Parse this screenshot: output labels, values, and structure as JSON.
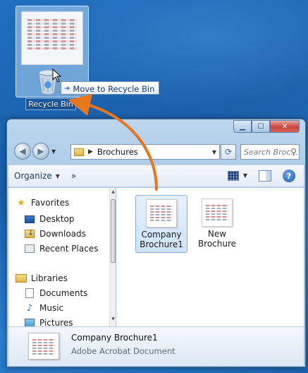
{
  "desktop": {
    "recycle_bin_label": "Recycle Bin",
    "drag_tooltip": "Move to Recycle Bin"
  },
  "window": {
    "address": {
      "folder": "Brochures"
    },
    "search": {
      "placeholder": "Search Broc..."
    },
    "toolbar": {
      "organize": "Organize",
      "more": "»"
    },
    "nav_pane": {
      "favorites_header": "Favorites",
      "favorites": [
        "Desktop",
        "Downloads",
        "Recent Places"
      ],
      "libraries_header": "Libraries",
      "libraries": [
        "Documents",
        "Music",
        "Pictures"
      ]
    },
    "files": [
      {
        "line1": "Company",
        "line2": "Brochure1",
        "selected": true
      },
      {
        "line1": "New",
        "line2": "Brochure",
        "selected": false
      }
    ],
    "details": {
      "name": "Company Brochure1",
      "type": "Adobe Acrobat Document"
    }
  },
  "colors": {
    "desktop_blue": "#1f6fc0",
    "drag_arrow": "#e8761e",
    "selection_fill": "#cfe3fb"
  },
  "icons": [
    "recycle-bin-icon",
    "cursor-arrow-icon",
    "folder-icon",
    "back-icon",
    "forward-icon",
    "refresh-icon",
    "search-icon",
    "views-icon",
    "preview-pane-icon",
    "help-icon",
    "star-icon",
    "desktop-icon",
    "downloads-icon",
    "recent-places-icon",
    "libraries-icon",
    "documents-icon",
    "music-icon",
    "pictures-icon",
    "minimize-icon",
    "maximize-icon",
    "close-icon"
  ]
}
